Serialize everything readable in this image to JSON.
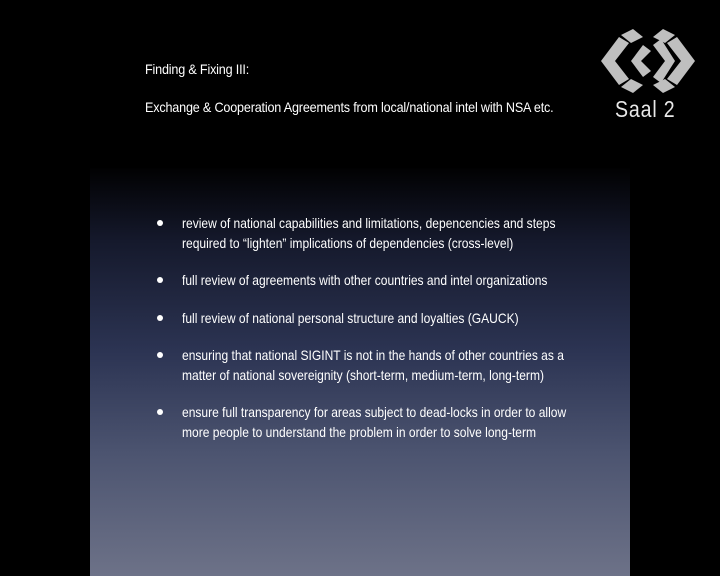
{
  "slide": {
    "heading": "Finding & Fixing III:",
    "subheading": "Exchange & Cooperation Agreements from local/national intel with NSA etc.",
    "bullets": [
      [
        "review of national capabilities and limitations, depencencies and steps",
        "required to “lighten” implications of dependencies (cross-level)"
      ],
      [
        "full review of agreements with other countries and intel organizations"
      ],
      [
        "full review of national personal structure and loyalties (GAUCK)"
      ],
      [
        "ensuring that national SIGINT is not in the hands of other countries as a",
        "matter of national sovereignity (short-term, medium-term, long-term)"
      ],
      [
        "ensure full transparency for areas subject to dead-locks in order to allow",
        "more people to understand the problem in order to solve long-term"
      ]
    ]
  },
  "broadcast": {
    "room_label": "Saal 2",
    "logo_icon": "ccc-room-logo-icon"
  }
}
